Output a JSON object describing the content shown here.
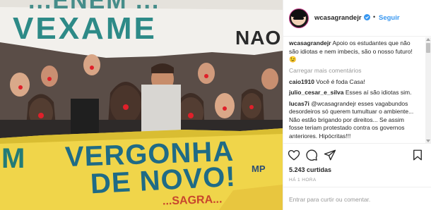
{
  "colors": {
    "link_blue": "#3897f0",
    "text_dark": "#262626",
    "text_muted": "#999999",
    "verified_blue": "#3897f0",
    "top_banner_text": "#2d8a87",
    "bottom_banner_bg": "#f0d54a",
    "bottom_banner_text": "#1f6b86"
  },
  "photo": {
    "top_banner": {
      "line1": "...ENEM ...",
      "main_word": "VEXAME",
      "right_word": "NAO"
    },
    "bottom_banner": {
      "line1": "VERGONHA",
      "line2": "DE NOVO!",
      "left_fragment": "M",
      "right_fragment": "MP",
      "bottom_fragment": "...SAGRA..."
    }
  },
  "header": {
    "username": "wcasagrandejr",
    "verified_icon": "verified-badge-icon",
    "separator": "•",
    "follow_label": "Seguir"
  },
  "caption": {
    "username": "wcasagrandejr",
    "text": "Apoio os estudantes que não são idiotas e nem imbecis, são o nosso futuro! 😉"
  },
  "load_more_label": "Carregar mais comentários",
  "comments": [
    {
      "username": "caio1910",
      "text": "Você é foda Casa!"
    },
    {
      "username": "julio_cesar_e_silva",
      "text": "Esses aí são idiotas sim."
    },
    {
      "username": "lucas7i",
      "text": "@wcasagrandejr esses vagabundos desordeiros só querem tumultuar o ambiente... Não estão brigando por direitos... Se assim fosse teriam protestado contra os governos anteriores. Hipócritas!!!"
    }
  ],
  "actions": {
    "like_icon": "heart-icon",
    "comment_icon": "comment-bubble-icon",
    "share_icon": "paper-plane-icon",
    "bookmark_icon": "bookmark-icon"
  },
  "likes": "5.243 curtidas",
  "time_ago": "HÁ 1 HORA",
  "comment_box": {
    "prefix": "Entrar",
    "placeholder": "Entrar para curtir ou comentar."
  }
}
